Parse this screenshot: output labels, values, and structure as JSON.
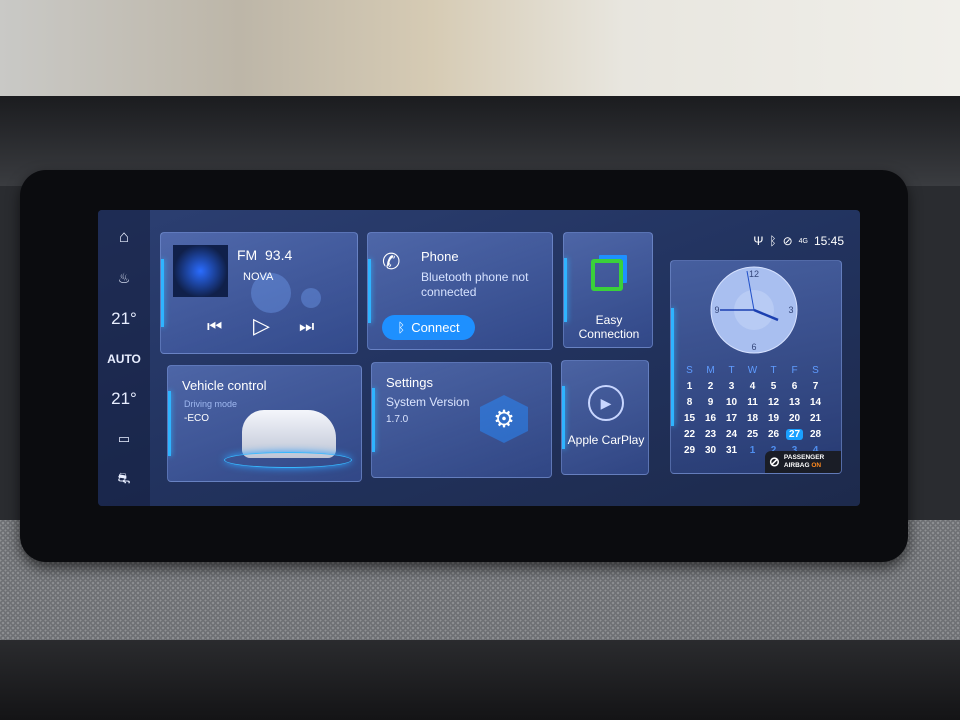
{
  "status": {
    "time": "15:45",
    "network": "4G",
    "icons": [
      "usb-icon",
      "bluetooth-icon",
      "wireless-icon",
      "signal-icon"
    ]
  },
  "sidebar": {
    "temp_left": "21°",
    "mode": "AUTO",
    "temp_right": "21°",
    "icons": [
      "home-icon",
      "front-defrost-icon",
      "rear-defrost-icon",
      "traction-icon"
    ]
  },
  "media": {
    "band": "FM",
    "frequency": "93.4",
    "station": "NOVA"
  },
  "phone": {
    "title": "Phone",
    "status": "Bluetooth phone not connected",
    "connect_label": "Connect"
  },
  "easy_connection": {
    "label": "Easy Connection"
  },
  "vehicle": {
    "title": "Vehicle control",
    "mode_label": "Driving mode",
    "mode_value": "-ECO"
  },
  "settings": {
    "title": "Settings",
    "version_label": "System Version",
    "version": "1.7.0"
  },
  "carplay": {
    "label": "Apple CarPlay"
  },
  "clock": {
    "numbers": [
      "12",
      "3",
      "6",
      "9"
    ],
    "hour": 3.75,
    "minute": 45
  },
  "calendar": {
    "weekdays": [
      "S",
      "M",
      "T",
      "W",
      "T",
      "F",
      "S"
    ],
    "weeks": [
      [
        "1",
        "2",
        "3",
        "4",
        "5",
        "6",
        "7"
      ],
      [
        "8",
        "9",
        "10",
        "11",
        "12",
        "13",
        "14"
      ],
      [
        "15",
        "16",
        "17",
        "18",
        "19",
        "20",
        "21"
      ],
      [
        "22",
        "23",
        "24",
        "25",
        "26",
        "27",
        "28"
      ],
      [
        "29",
        "30",
        "31",
        "1",
        "2",
        "3",
        "4"
      ]
    ],
    "today": "27"
  },
  "airbag": {
    "line1": "PASSENGER",
    "line2": "AIRBAG",
    "state": "ON",
    "state_color": "#ff8a1f"
  },
  "colors": {
    "accent": "#1e90ff",
    "easy_green": "#3ad13a"
  }
}
